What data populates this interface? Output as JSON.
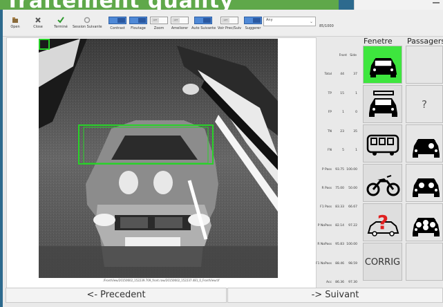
{
  "banner": {
    "title": "Traitement quality"
  },
  "toolbar": {
    "buttons": [
      {
        "label": "Open",
        "icon": "open-icon"
      },
      {
        "label": "Close",
        "icon": "close-icon"
      },
      {
        "label": "Terminé",
        "icon": "check-icon"
      },
      {
        "label": "Session Suivante",
        "icon": "session-icon"
      }
    ],
    "toggles": [
      {
        "label": "Contrast",
        "state": "on",
        "text": ""
      },
      {
        "label": "Floutage",
        "state": "on",
        "text": ""
      },
      {
        "label": "Zoom",
        "state": "off",
        "text": "OFF"
      },
      {
        "label": "Ameliorer",
        "state": "off",
        "text": "OFF"
      },
      {
        "label": "Auto Suivante",
        "state": "on",
        "text": ""
      },
      {
        "label": "Voir Prec/Suiv",
        "state": "off",
        "text": "OFF"
      },
      {
        "label": "Suggerer",
        "state": "on",
        "text": ""
      }
    ],
    "select_value": "Any",
    "count": "85/1000"
  },
  "image": {
    "caption": "/FrontView/20150602_152239.709_front.raw/20150602_152237.481_0_FrontView.tif"
  },
  "stats": {
    "headers": [
      "Front",
      "Side"
    ],
    "rows": [
      {
        "name": "Total",
        "front": "44",
        "side": "37"
      },
      {
        "name": "TP",
        "front": "15",
        "side": "1"
      },
      {
        "name": "FP",
        "front": "1",
        "side": "0"
      },
      {
        "name": "TN",
        "front": "23",
        "side": "35"
      },
      {
        "name": "FN",
        "front": "5",
        "side": "1"
      },
      {
        "name": "P Pass",
        "front": "93.75",
        "side": "100.00"
      },
      {
        "name": "R Pass",
        "front": "75.00",
        "side": "50.00"
      },
      {
        "name": "F1 Pass",
        "front": "83.33",
        "side": "66.67"
      },
      {
        "name": "P NoPass",
        "front": "82.14",
        "side": "97.22"
      },
      {
        "name": "R NoPass",
        "front": "95.83",
        "side": "100.00"
      },
      {
        "name": "F1 NoPass",
        "front": "88.46",
        "side": "98.59"
      },
      {
        "name": "Acc",
        "front": "86.36",
        "side": "97.30"
      }
    ]
  },
  "grid": {
    "fenetre_label": "Fenetre",
    "passagers_label": "Passagers",
    "corrig_label": "CORRIG",
    "question_mark": "?",
    "fenetre": [
      {
        "icon": "car-window-front-icon",
        "state": "selected"
      },
      {
        "icon": "car-window-side-icon",
        "state": "normal"
      },
      {
        "icon": "bus-icon",
        "state": "normal"
      },
      {
        "icon": "motorcycle-icon",
        "state": "normal"
      },
      {
        "icon": "unknown-car-icon",
        "state": "normal"
      },
      {
        "icon": "corrig",
        "state": "normal"
      }
    ],
    "passagers": [
      {
        "icon": "empty",
        "state": "normal"
      },
      {
        "icon": "question-icon",
        "state": "normal"
      },
      {
        "icon": "car-one-passenger-icon",
        "state": "normal"
      },
      {
        "icon": "car-two-passengers-icon",
        "state": "selected"
      },
      {
        "icon": "car-many-passengers-icon",
        "state": "normal"
      },
      {
        "icon": "empty",
        "state": "normal"
      }
    ]
  },
  "nav": {
    "prev": "<- Precedent",
    "next": "-> Suivant"
  },
  "colors": {
    "accent_green": "#3ee63e",
    "toggle_blue": "#4f89d6",
    "background": "#2d6a8e"
  }
}
